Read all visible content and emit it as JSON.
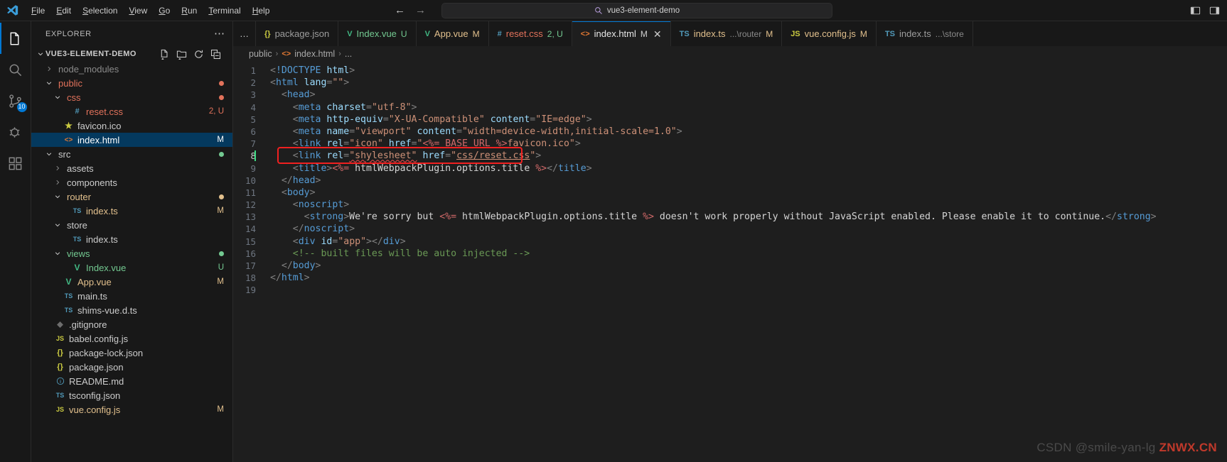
{
  "titlebar": {
    "logo_icon": "vscode-logo-icon",
    "menus": [
      {
        "label": "File",
        "accel": "F"
      },
      {
        "label": "Edit",
        "accel": "E"
      },
      {
        "label": "Selection",
        "accel": "S"
      },
      {
        "label": "View",
        "accel": "V"
      },
      {
        "label": "Go",
        "accel": "G"
      },
      {
        "label": "Run",
        "accel": "R"
      },
      {
        "label": "Terminal",
        "accel": "T"
      },
      {
        "label": "Help",
        "accel": "H"
      }
    ],
    "back_icon": "arrow-left-icon",
    "forward_icon": "arrow-right-icon",
    "quickopen": {
      "icon": "search-icon",
      "value": "vue3-element-demo",
      "placeholder": "Search"
    },
    "window_actions": [
      {
        "name": "toggle-panel-layout-icon"
      },
      {
        "name": "customize-layout-icon"
      }
    ]
  },
  "activitybar": {
    "items": [
      {
        "name": "explorer",
        "icon": "files-icon",
        "active": true,
        "badge": ""
      },
      {
        "name": "search",
        "icon": "search-icon",
        "active": false,
        "badge": ""
      },
      {
        "name": "source-control",
        "icon": "source-control-icon",
        "active": false,
        "badge": "10"
      },
      {
        "name": "run-and-debug",
        "icon": "debug-icon",
        "active": false,
        "badge": ""
      },
      {
        "name": "extensions",
        "icon": "extensions-icon",
        "active": false,
        "badge": ""
      }
    ]
  },
  "sidebar": {
    "title": "EXPLORER",
    "more_actions_icon": "ellipsis-icon",
    "root": {
      "label": "VUE3-ELEMENT-DEMO",
      "expanded": true,
      "actions": [
        {
          "name": "new-file-icon"
        },
        {
          "name": "new-folder-icon"
        },
        {
          "name": "refresh-icon"
        },
        {
          "name": "collapse-all-icon"
        }
      ]
    },
    "tree": [
      {
        "label": "node_modules",
        "type": "folder",
        "indent": 1,
        "expanded": false,
        "color": "#8a8a8a",
        "badge": "",
        "dot": ""
      },
      {
        "label": "public",
        "type": "folder",
        "indent": 1,
        "expanded": true,
        "color": "#e2725b",
        "badge": "",
        "dot": "#e2725b"
      },
      {
        "label": "css",
        "type": "folder",
        "indent": 2,
        "expanded": true,
        "color": "#e2725b",
        "badge": "",
        "dot": "#e2725b"
      },
      {
        "label": "reset.css",
        "type": "css",
        "indent": 3,
        "color": "#e2725b",
        "badge": "2, U",
        "dot": ""
      },
      {
        "label": "favicon.ico",
        "type": "ico",
        "indent": 2,
        "color": "#cccccc",
        "badge": "",
        "dot": ""
      },
      {
        "label": "index.html",
        "type": "html",
        "indent": 2,
        "color": "#ffffff",
        "badge": "M",
        "dot": "",
        "selected": true
      },
      {
        "label": "src",
        "type": "folder",
        "indent": 1,
        "expanded": true,
        "color": "#cccccc",
        "badge": "",
        "dot": "#73c991"
      },
      {
        "label": "assets",
        "type": "folder",
        "indent": 2,
        "expanded": false,
        "color": "#cccccc",
        "badge": "",
        "dot": ""
      },
      {
        "label": "components",
        "type": "folder",
        "indent": 2,
        "expanded": false,
        "color": "#cccccc",
        "badge": "",
        "dot": ""
      },
      {
        "label": "router",
        "type": "folder",
        "indent": 2,
        "expanded": true,
        "color": "#e2c08d",
        "badge": "",
        "dot": "#e2c08d"
      },
      {
        "label": "index.ts",
        "type": "ts",
        "indent": 3,
        "color": "#e2c08d",
        "badge": "M",
        "dot": ""
      },
      {
        "label": "store",
        "type": "folder",
        "indent": 2,
        "expanded": true,
        "color": "#cccccc",
        "badge": "",
        "dot": ""
      },
      {
        "label": "index.ts",
        "type": "ts",
        "indent": 3,
        "color": "#cccccc",
        "badge": "",
        "dot": ""
      },
      {
        "label": "views",
        "type": "folder",
        "indent": 2,
        "expanded": true,
        "color": "#73c991",
        "badge": "",
        "dot": "#73c991"
      },
      {
        "label": "Index.vue",
        "type": "vue",
        "indent": 3,
        "color": "#73c991",
        "badge": "U",
        "dot": ""
      },
      {
        "label": "App.vue",
        "type": "vue",
        "indent": 2,
        "color": "#e2c08d",
        "badge": "M",
        "dot": ""
      },
      {
        "label": "main.ts",
        "type": "ts",
        "indent": 2,
        "color": "#cccccc",
        "badge": "",
        "dot": ""
      },
      {
        "label": "shims-vue.d.ts",
        "type": "ts",
        "indent": 2,
        "color": "#cccccc",
        "badge": "",
        "dot": ""
      },
      {
        "label": ".gitignore",
        "type": "git",
        "indent": 1,
        "color": "#cccccc",
        "badge": "",
        "dot": ""
      },
      {
        "label": "babel.config.js",
        "type": "js",
        "indent": 1,
        "color": "#cccccc",
        "badge": "",
        "dot": ""
      },
      {
        "label": "package-lock.json",
        "type": "json",
        "indent": 1,
        "color": "#cccccc",
        "badge": "",
        "dot": ""
      },
      {
        "label": "package.json",
        "type": "json",
        "indent": 1,
        "color": "#cccccc",
        "badge": "",
        "dot": ""
      },
      {
        "label": "README.md",
        "type": "md",
        "indent": 1,
        "color": "#cccccc",
        "badge": "",
        "dot": ""
      },
      {
        "label": "tsconfig.json",
        "type": "tsconfig",
        "indent": 1,
        "color": "#cccccc",
        "badge": "",
        "dot": ""
      },
      {
        "label": "vue.config.js",
        "type": "js",
        "indent": 1,
        "color": "#e2c08d",
        "badge": "M",
        "dot": ""
      }
    ]
  },
  "tabs": [
    {
      "name": "package.json",
      "icon": "json-icon",
      "icon_color": "#cbcb41",
      "icon_text": "{}",
      "sub": "",
      "mod": "",
      "mod_class": "",
      "active": false,
      "closable": false,
      "color": "#9d9d9d"
    },
    {
      "name": "Index.vue",
      "icon": "vue-icon",
      "icon_color": "#41b883",
      "icon_text": "V",
      "sub": "",
      "mod": "U",
      "mod_class": "u",
      "active": false,
      "closable": false,
      "color": "#73c991"
    },
    {
      "name": "App.vue",
      "icon": "vue-icon",
      "icon_color": "#41b883",
      "icon_text": "V",
      "sub": "",
      "mod": "M",
      "mod_class": "warn",
      "active": false,
      "closable": false,
      "color": "#e2c08d"
    },
    {
      "name": "reset.css",
      "icon": "css-icon",
      "icon_color": "#519aba",
      "icon_text": "#",
      "sub": "",
      "mod": "2, U",
      "mod_class": "u",
      "active": false,
      "closable": false,
      "color": "#e2725b"
    },
    {
      "name": "index.html",
      "icon": "html-icon",
      "icon_color": "#e37933",
      "icon_text": "<>",
      "sub": "",
      "mod": "M",
      "mod_class": "",
      "active": true,
      "closable": true,
      "color": "#e7e7e7"
    },
    {
      "name": "index.ts",
      "icon": "ts-icon",
      "icon_color": "#519aba",
      "icon_text": "TS",
      "sub": "...\\router",
      "mod": "M",
      "mod_class": "warn",
      "active": false,
      "closable": false,
      "color": "#e2c08d"
    },
    {
      "name": "vue.config.js",
      "icon": "js-icon",
      "icon_color": "#cbcb41",
      "icon_text": "JS",
      "sub": "",
      "mod": "M",
      "mod_class": "warn",
      "active": false,
      "closable": false,
      "color": "#e2c08d"
    },
    {
      "name": "index.ts",
      "icon": "ts-icon",
      "icon_color": "#519aba",
      "icon_text": "TS",
      "sub": "...\\store",
      "mod": "",
      "mod_class": "",
      "active": false,
      "closable": false,
      "color": "#9d9d9d"
    }
  ],
  "breadcrumb": {
    "items": [
      {
        "label": "public",
        "icon": "",
        "icon_color": ""
      },
      {
        "label": "index.html",
        "icon": "<>",
        "icon_color": "#e37933"
      },
      {
        "label": "...",
        "icon": "",
        "icon_color": ""
      }
    ],
    "separator": "›"
  },
  "editor": {
    "filename": "index.html",
    "cursor_line": 8,
    "total_lines": 19,
    "annotation": {
      "name": "error-highlight-box",
      "color": "#f02020",
      "line": 8
    },
    "lines": [
      {
        "n": 1,
        "tokens": [
          {
            "t": "<",
            "c": "t-punc"
          },
          {
            "t": "!DOCTYPE",
            "c": "t-dt"
          },
          {
            "t": " ",
            "c": "t-txt"
          },
          {
            "t": "html",
            "c": "t-dtn"
          },
          {
            "t": ">",
            "c": "t-punc"
          }
        ]
      },
      {
        "n": 2,
        "tokens": [
          {
            "t": "<",
            "c": "t-punc"
          },
          {
            "t": "html",
            "c": "t-tag"
          },
          {
            "t": " ",
            "c": "t-txt"
          },
          {
            "t": "lang",
            "c": "t-attr"
          },
          {
            "t": "=",
            "c": "t-punc"
          },
          {
            "t": "\"\"",
            "c": "t-str"
          },
          {
            "t": ">",
            "c": "t-punc"
          }
        ]
      },
      {
        "n": 3,
        "tokens": [
          {
            "t": "  <",
            "c": "t-punc"
          },
          {
            "t": "head",
            "c": "t-tag"
          },
          {
            "t": ">",
            "c": "t-punc"
          }
        ]
      },
      {
        "n": 4,
        "tokens": [
          {
            "t": "    <",
            "c": "t-punc"
          },
          {
            "t": "meta",
            "c": "t-tag"
          },
          {
            "t": " ",
            "c": "t-txt"
          },
          {
            "t": "charset",
            "c": "t-attr"
          },
          {
            "t": "=",
            "c": "t-punc"
          },
          {
            "t": "\"utf-8\"",
            "c": "t-str"
          },
          {
            "t": ">",
            "c": "t-punc"
          }
        ]
      },
      {
        "n": 5,
        "tokens": [
          {
            "t": "    <",
            "c": "t-punc"
          },
          {
            "t": "meta",
            "c": "t-tag"
          },
          {
            "t": " ",
            "c": "t-txt"
          },
          {
            "t": "http-equiv",
            "c": "t-attr"
          },
          {
            "t": "=",
            "c": "t-punc"
          },
          {
            "t": "\"X-UA-Compatible\"",
            "c": "t-str"
          },
          {
            "t": " ",
            "c": "t-txt"
          },
          {
            "t": "content",
            "c": "t-attr"
          },
          {
            "t": "=",
            "c": "t-punc"
          },
          {
            "t": "\"IE=edge\"",
            "c": "t-str"
          },
          {
            "t": ">",
            "c": "t-punc"
          }
        ]
      },
      {
        "n": 6,
        "tokens": [
          {
            "t": "    <",
            "c": "t-punc"
          },
          {
            "t": "meta",
            "c": "t-tag"
          },
          {
            "t": " ",
            "c": "t-txt"
          },
          {
            "t": "name",
            "c": "t-attr"
          },
          {
            "t": "=",
            "c": "t-punc"
          },
          {
            "t": "\"viewport\"",
            "c": "t-str"
          },
          {
            "t": " ",
            "c": "t-txt"
          },
          {
            "t": "content",
            "c": "t-attr"
          },
          {
            "t": "=",
            "c": "t-punc"
          },
          {
            "t": "\"width=device-width,initial-scale=1.0\"",
            "c": "t-str"
          },
          {
            "t": ">",
            "c": "t-punc"
          }
        ]
      },
      {
        "n": 7,
        "tokens": [
          {
            "t": "    <",
            "c": "t-punc"
          },
          {
            "t": "link",
            "c": "t-tag"
          },
          {
            "t": " ",
            "c": "t-txt"
          },
          {
            "t": "rel",
            "c": "t-attr"
          },
          {
            "t": "=",
            "c": "t-punc"
          },
          {
            "t": "\"icon\"",
            "c": "t-str"
          },
          {
            "t": " ",
            "c": "t-txt"
          },
          {
            "t": "href",
            "c": "t-attr"
          },
          {
            "t": "=",
            "c": "t-punc"
          },
          {
            "t": "\"",
            "c": "t-str"
          },
          {
            "t": "<%= BASE_URL %>",
            "c": "t-ejs"
          },
          {
            "t": "favicon.ico\"",
            "c": "t-str"
          },
          {
            "t": ">",
            "c": "t-punc"
          }
        ]
      },
      {
        "n": 8,
        "tokens": [
          {
            "t": "    <",
            "c": "t-punc"
          },
          {
            "t": "link",
            "c": "t-tag"
          },
          {
            "t": " ",
            "c": "t-txt"
          },
          {
            "t": "rel",
            "c": "t-attr"
          },
          {
            "t": "=",
            "c": "t-punc"
          },
          {
            "t": "\"shylesheet\"",
            "c": "t-str err-underline"
          },
          {
            "t": " ",
            "c": "t-txt"
          },
          {
            "t": "href",
            "c": "t-attr"
          },
          {
            "t": "=",
            "c": "t-punc"
          },
          {
            "t": "\"",
            "c": "t-str"
          },
          {
            "t": "css/reset.css",
            "c": "t-str link-underline"
          },
          {
            "t": "\"",
            "c": "t-str"
          },
          {
            "t": ">",
            "c": "t-punc"
          }
        ]
      },
      {
        "n": 9,
        "tokens": [
          {
            "t": "    <",
            "c": "t-punc"
          },
          {
            "t": "title",
            "c": "t-tag"
          },
          {
            "t": ">",
            "c": "t-punc"
          },
          {
            "t": "<%=",
            "c": "t-ejs"
          },
          {
            "t": " htmlWebpackPlugin.options.title ",
            "c": "t-txt"
          },
          {
            "t": "%>",
            "c": "t-ejs"
          },
          {
            "t": "</",
            "c": "t-punc"
          },
          {
            "t": "title",
            "c": "t-tag"
          },
          {
            "t": ">",
            "c": "t-punc"
          }
        ]
      },
      {
        "n": 10,
        "tokens": [
          {
            "t": "  </",
            "c": "t-punc"
          },
          {
            "t": "head",
            "c": "t-tag"
          },
          {
            "t": ">",
            "c": "t-punc"
          }
        ]
      },
      {
        "n": 11,
        "tokens": [
          {
            "t": "  <",
            "c": "t-punc"
          },
          {
            "t": "body",
            "c": "t-tag"
          },
          {
            "t": ">",
            "c": "t-punc"
          }
        ]
      },
      {
        "n": 12,
        "tokens": [
          {
            "t": "    <",
            "c": "t-punc"
          },
          {
            "t": "noscript",
            "c": "t-tag"
          },
          {
            "t": ">",
            "c": "t-punc"
          }
        ]
      },
      {
        "n": 13,
        "tokens": [
          {
            "t": "      <",
            "c": "t-punc"
          },
          {
            "t": "strong",
            "c": "t-tag"
          },
          {
            "t": ">",
            "c": "t-punc"
          },
          {
            "t": "We're sorry but ",
            "c": "t-txt"
          },
          {
            "t": "<%=",
            "c": "t-ejs"
          },
          {
            "t": " htmlWebpackPlugin.options.title ",
            "c": "t-txt"
          },
          {
            "t": "%>",
            "c": "t-ejs"
          },
          {
            "t": " doesn't work properly without JavaScript enabled. Please enable it to continue.",
            "c": "t-txt"
          },
          {
            "t": "</",
            "c": "t-punc"
          },
          {
            "t": "strong",
            "c": "t-tag"
          },
          {
            "t": ">",
            "c": "t-punc"
          }
        ]
      },
      {
        "n": 14,
        "tokens": [
          {
            "t": "    </",
            "c": "t-punc"
          },
          {
            "t": "noscript",
            "c": "t-tag"
          },
          {
            "t": ">",
            "c": "t-punc"
          }
        ]
      },
      {
        "n": 15,
        "tokens": [
          {
            "t": "    <",
            "c": "t-punc"
          },
          {
            "t": "div",
            "c": "t-tag"
          },
          {
            "t": " ",
            "c": "t-txt"
          },
          {
            "t": "id",
            "c": "t-attr"
          },
          {
            "t": "=",
            "c": "t-punc"
          },
          {
            "t": "\"app\"",
            "c": "t-str"
          },
          {
            "t": "></",
            "c": "t-punc"
          },
          {
            "t": "div",
            "c": "t-tag"
          },
          {
            "t": ">",
            "c": "t-punc"
          }
        ]
      },
      {
        "n": 16,
        "tokens": [
          {
            "t": "    <!-- built files will be auto injected -->",
            "c": "t-comment"
          }
        ]
      },
      {
        "n": 17,
        "tokens": [
          {
            "t": "  </",
            "c": "t-punc"
          },
          {
            "t": "body",
            "c": "t-tag"
          },
          {
            "t": ">",
            "c": "t-punc"
          }
        ]
      },
      {
        "n": 18,
        "tokens": [
          {
            "t": "</",
            "c": "t-punc"
          },
          {
            "t": "html",
            "c": "t-tag"
          },
          {
            "t": ">",
            "c": "t-punc"
          }
        ]
      },
      {
        "n": 19,
        "tokens": []
      }
    ]
  },
  "watermark": {
    "prefix": "CSDN @smile-yan-lg",
    "brand": "ZNWX.CN"
  }
}
